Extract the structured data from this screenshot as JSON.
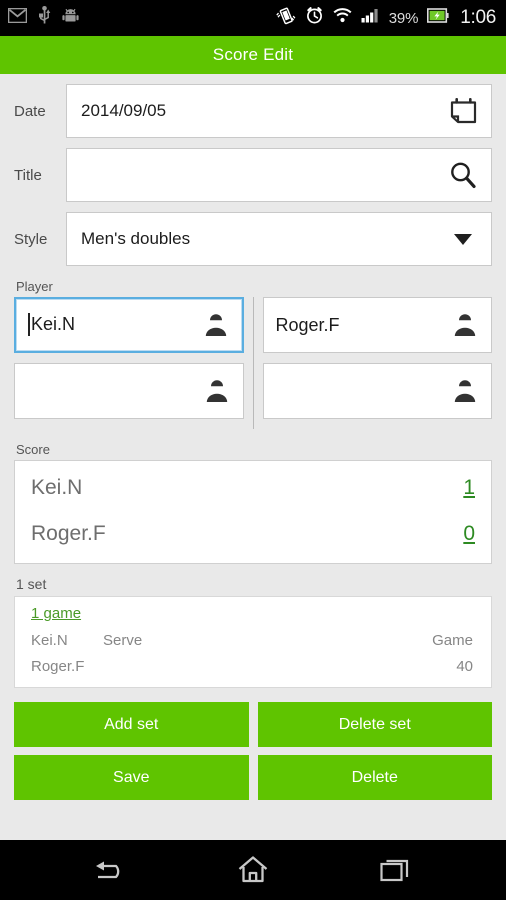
{
  "status_bar": {
    "left_icons": [
      "gmail-icon",
      "usb-icon",
      "android-icon"
    ],
    "right_icons": [
      "vibrate-icon",
      "alarm-icon",
      "wifi-icon",
      "signal-icon",
      "battery-charging-icon"
    ],
    "battery_percent": "39%",
    "clock": "1:06"
  },
  "title_bar": {
    "title": "Score Edit",
    "color": "#5fc400"
  },
  "form": {
    "date": {
      "label": "Date",
      "value": "2014/09/05",
      "icon": "calendar-icon"
    },
    "title": {
      "label": "Title",
      "value": "",
      "placeholder": "",
      "icon": "search-icon"
    },
    "style": {
      "label": "Style",
      "value": "Men's doubles",
      "icon": "chevron-down-icon",
      "options": [
        "Men's doubles"
      ]
    }
  },
  "player": {
    "section_label": "Player",
    "left": [
      {
        "value": "Kei.N",
        "focused": true,
        "icon": "person-icon"
      },
      {
        "value": "",
        "focused": false,
        "icon": "person-icon"
      }
    ],
    "right": [
      {
        "value": "Roger.F",
        "focused": false,
        "icon": "person-icon"
      },
      {
        "value": "",
        "focused": false,
        "icon": "person-icon"
      }
    ]
  },
  "score": {
    "section_label": "Score",
    "rows": [
      {
        "name": "Kei.N",
        "value": "1"
      },
      {
        "name": "Roger.F",
        "value": "0"
      }
    ],
    "value_color": "#2d8a22"
  },
  "set": {
    "label": "1 set",
    "game_link": "1 game",
    "rows": [
      {
        "player": "Kei.N",
        "serve": "Serve",
        "score": "Game"
      },
      {
        "player": "Roger.F",
        "serve": "",
        "score": "40"
      }
    ]
  },
  "buttons": {
    "add_set": "Add set",
    "delete_set": "Delete set",
    "save": "Save",
    "delete": "Delete"
  },
  "nav_bar": {
    "back": "back-icon",
    "home": "home-icon",
    "recents": "recents-icon"
  }
}
